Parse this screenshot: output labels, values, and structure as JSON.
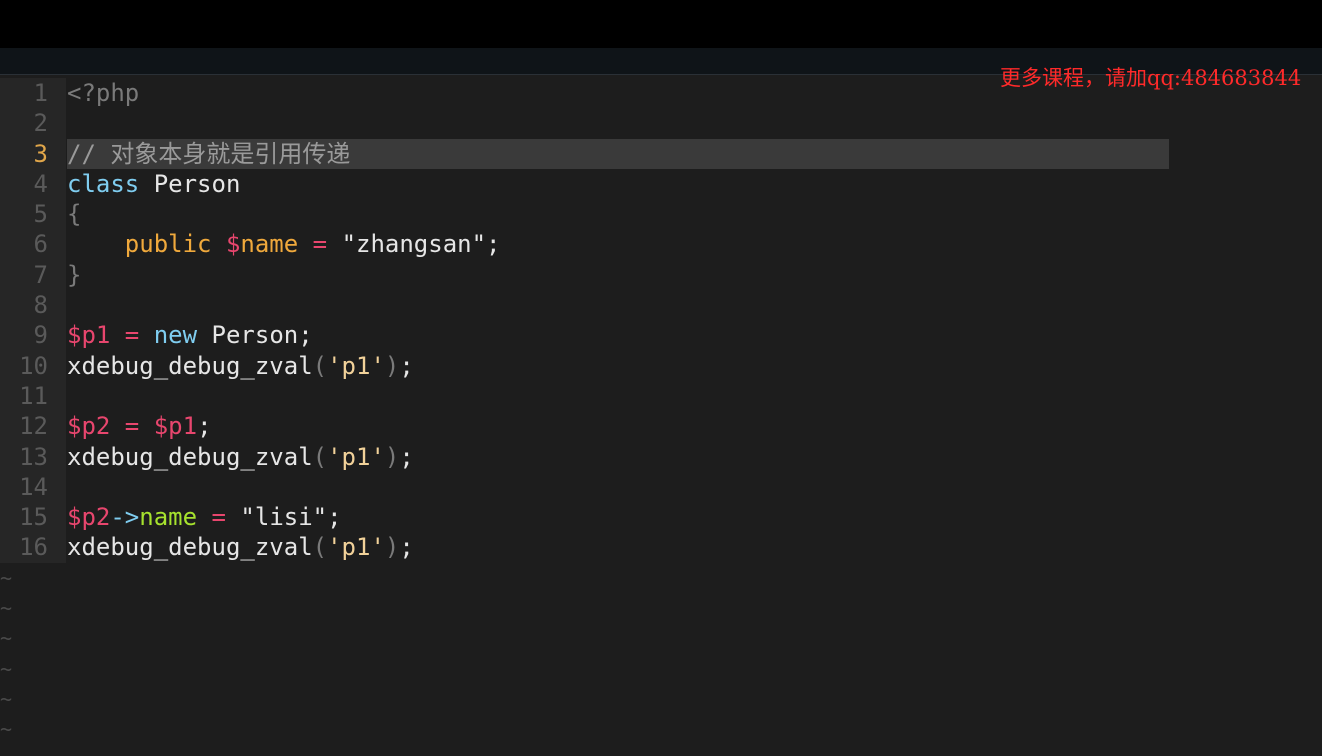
{
  "watermark": "更多课程，请加qq:484683844",
  "lines": [
    {
      "num": "1",
      "tokens": [
        {
          "t": "<?php",
          "c": "tk-dim"
        }
      ]
    },
    {
      "num": "2",
      "tokens": []
    },
    {
      "num": "3",
      "current": true,
      "tokens": [
        {
          "t": "// 对象本身就是引用传递",
          "c": "tk-cmt"
        }
      ]
    },
    {
      "num": "4",
      "tokens": [
        {
          "t": "class",
          "c": "tk-kw"
        },
        {
          "t": " Person",
          "c": "tk-plain"
        }
      ]
    },
    {
      "num": "5",
      "tokens": [
        {
          "t": "{",
          "c": "tk-dim"
        }
      ]
    },
    {
      "num": "6",
      "tokens": [
        {
          "t": "    public ",
          "c": "tk-kw2"
        },
        {
          "t": "$",
          "c": "tk-var"
        },
        {
          "t": "name",
          "c": "tk-kw2"
        },
        {
          "t": " = ",
          "c": "tk-op"
        },
        {
          "t": "\"zhangsan\";",
          "c": "tk-plain"
        }
      ]
    },
    {
      "num": "7",
      "tokens": [
        {
          "t": "}",
          "c": "tk-dim"
        }
      ]
    },
    {
      "num": "8",
      "tokens": []
    },
    {
      "num": "9",
      "tokens": [
        {
          "t": "$p1",
          "c": "tk-var"
        },
        {
          "t": " = ",
          "c": "tk-op"
        },
        {
          "t": "new",
          "c": "tk-kw"
        },
        {
          "t": " Person;",
          "c": "tk-plain"
        }
      ]
    },
    {
      "num": "10",
      "tokens": [
        {
          "t": "xdebug_debug_zval",
          "c": "tk-plain"
        },
        {
          "t": "(",
          "c": "tk-dim"
        },
        {
          "t": "'p1'",
          "c": "tk-str"
        },
        {
          "t": ")",
          "c": "tk-dim"
        },
        {
          "t": ";",
          "c": "tk-plain"
        }
      ]
    },
    {
      "num": "11",
      "tokens": []
    },
    {
      "num": "12",
      "tokens": [
        {
          "t": "$p2",
          "c": "tk-var"
        },
        {
          "t": " = ",
          "c": "tk-op"
        },
        {
          "t": "$p1",
          "c": "tk-var"
        },
        {
          "t": ";",
          "c": "tk-plain"
        }
      ]
    },
    {
      "num": "13",
      "tokens": [
        {
          "t": "xdebug_debug_zval",
          "c": "tk-plain"
        },
        {
          "t": "(",
          "c": "tk-dim"
        },
        {
          "t": "'p1'",
          "c": "tk-str"
        },
        {
          "t": ")",
          "c": "tk-dim"
        },
        {
          "t": ";",
          "c": "tk-plain"
        }
      ]
    },
    {
      "num": "14",
      "tokens": []
    },
    {
      "num": "15",
      "tokens": [
        {
          "t": "$p2",
          "c": "tk-var"
        },
        {
          "t": "->",
          "c": "tk-arrow"
        },
        {
          "t": "name",
          "c": "tk-prop"
        },
        {
          "t": " = ",
          "c": "tk-op"
        },
        {
          "t": "\"lisi\";",
          "c": "tk-plain"
        }
      ]
    },
    {
      "num": "16",
      "tokens": [
        {
          "t": "xdebug_debug_zval",
          "c": "tk-plain"
        },
        {
          "t": "(",
          "c": "tk-dim"
        },
        {
          "t": "'p1'",
          "c": "tk-str"
        },
        {
          "t": ")",
          "c": "tk-dim"
        },
        {
          "t": ";",
          "c": "tk-plain"
        }
      ]
    }
  ],
  "tildes": [
    "~",
    "~",
    "~",
    "~",
    "~",
    "~"
  ]
}
